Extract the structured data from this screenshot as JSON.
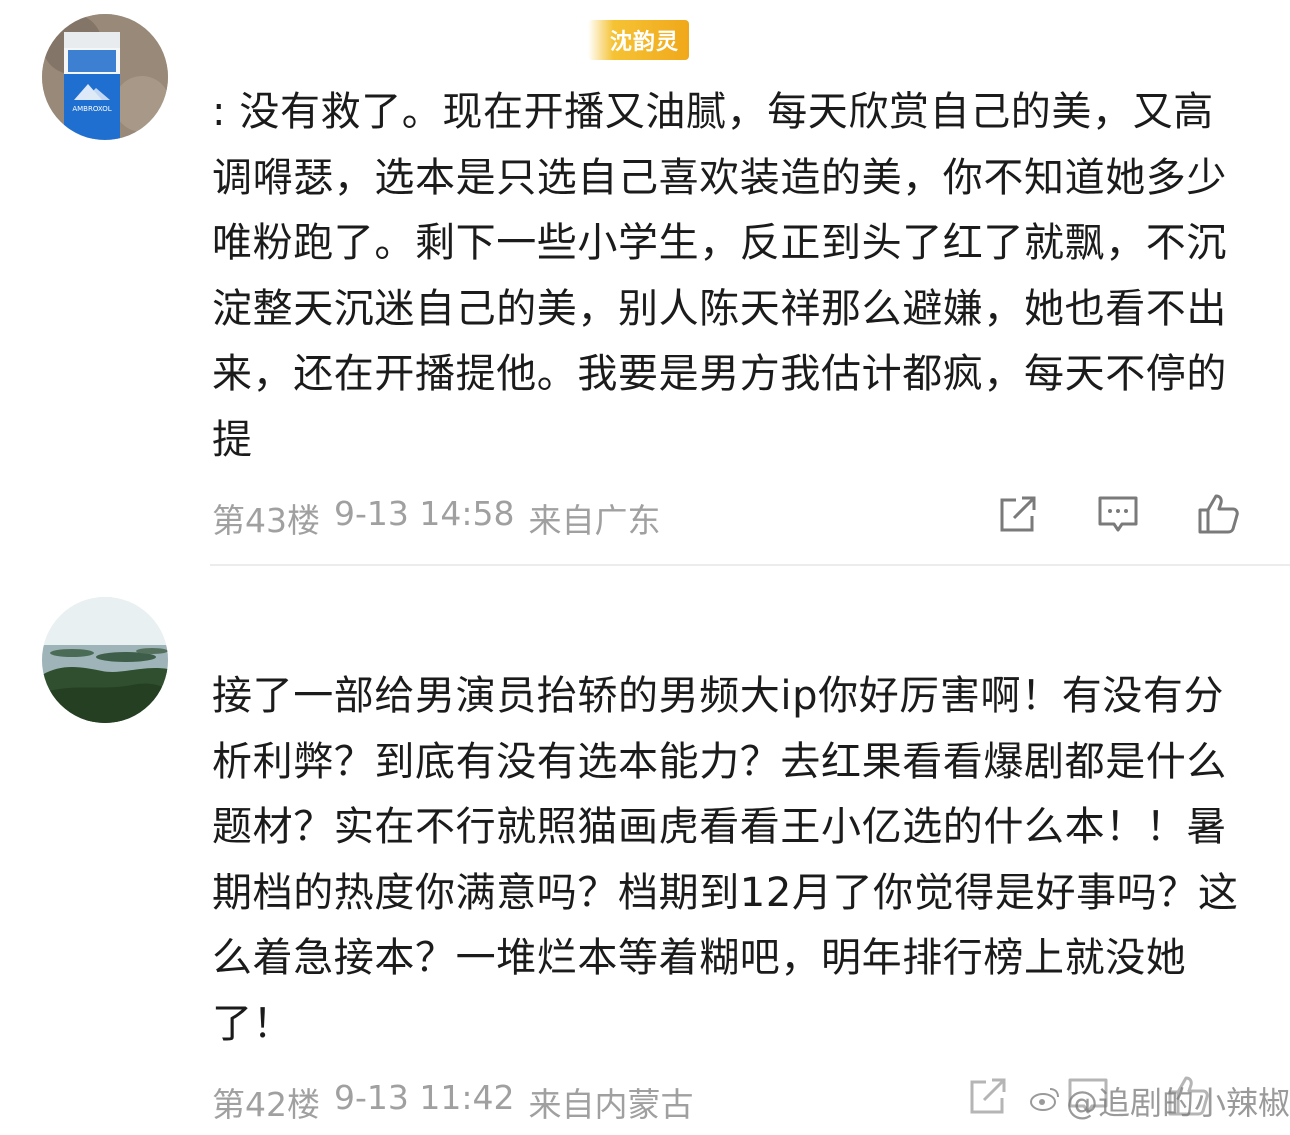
{
  "comments": [
    {
      "username": "沈韵灵",
      "text": ": 没有救了。现在开播又油腻，每天欣赏自己的美，又高调嘚瑟，选本是只选自己喜欢装造的美，你不知道她多少唯粉跑了。剩下一些小学生，反正到头了红了就飘，不沉淀整天沉迷自己的美，别人陈天祥那么避嫌，她也看不出来，还在开播提他。我要是男方我估计都疯，每天不停的提",
      "floor": "第43楼",
      "datetime": "9-13 14:58",
      "location": "来自广东",
      "avatar_image": "AMBROXOL"
    },
    {
      "username": "",
      "text": "接了一部给男演员抬轿的男频大ip你好厉害啊！有没有分析利弊？到底有没有选本能力？去红果看看爆剧都是什么题材？实在不行就照猫画虎看看王小亿选的什么本！！暑期档的热度你满意吗？档期到12月了你觉得是好事吗？这么着急接本？一堆烂本等着糊吧，明年排行榜上就没她了！",
      "floor": "第42楼",
      "datetime": "9-13 11:42",
      "location": "来自内蒙古"
    }
  ],
  "actions": {
    "share_icon": "share-icon",
    "comment_icon": "comment-icon",
    "like_icon": "like-icon"
  },
  "watermark": {
    "text": "@追剧的小辣椒"
  },
  "colors": {
    "badge": "#f0a81a",
    "meta": "#a0a0a0",
    "text": "#1b1b1b"
  }
}
